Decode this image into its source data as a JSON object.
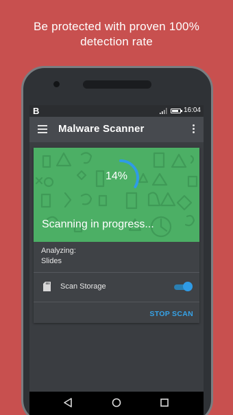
{
  "headline": {
    "line1": "Be protected with proven 100%",
    "line2": "detection rate"
  },
  "statusbar": {
    "app_glyph": "B",
    "time": "16:04",
    "icons": [
      "signal-icon",
      "battery-icon"
    ]
  },
  "appbar": {
    "title": "Malware Scanner",
    "menu_icon": "hamburger-icon",
    "more_icon": "more-vert-icon"
  },
  "scan": {
    "percent_text": "14%",
    "progress": 0.14,
    "status": "Scanning in progress...",
    "analyzing_label": "Analyzing:",
    "analyzing_item": "Slides"
  },
  "storage": {
    "label": "Scan Storage",
    "enabled": true,
    "icon": "sd-card-icon"
  },
  "actions": {
    "stop_label": "STOP SCAN"
  },
  "navbar": {
    "icons": [
      "back-icon",
      "home-icon",
      "recents-icon"
    ]
  },
  "colors": {
    "background": "#c8504f",
    "hero_green": "#4caf65",
    "accent_blue": "#36a3e8",
    "appbar": "#474a4f"
  }
}
